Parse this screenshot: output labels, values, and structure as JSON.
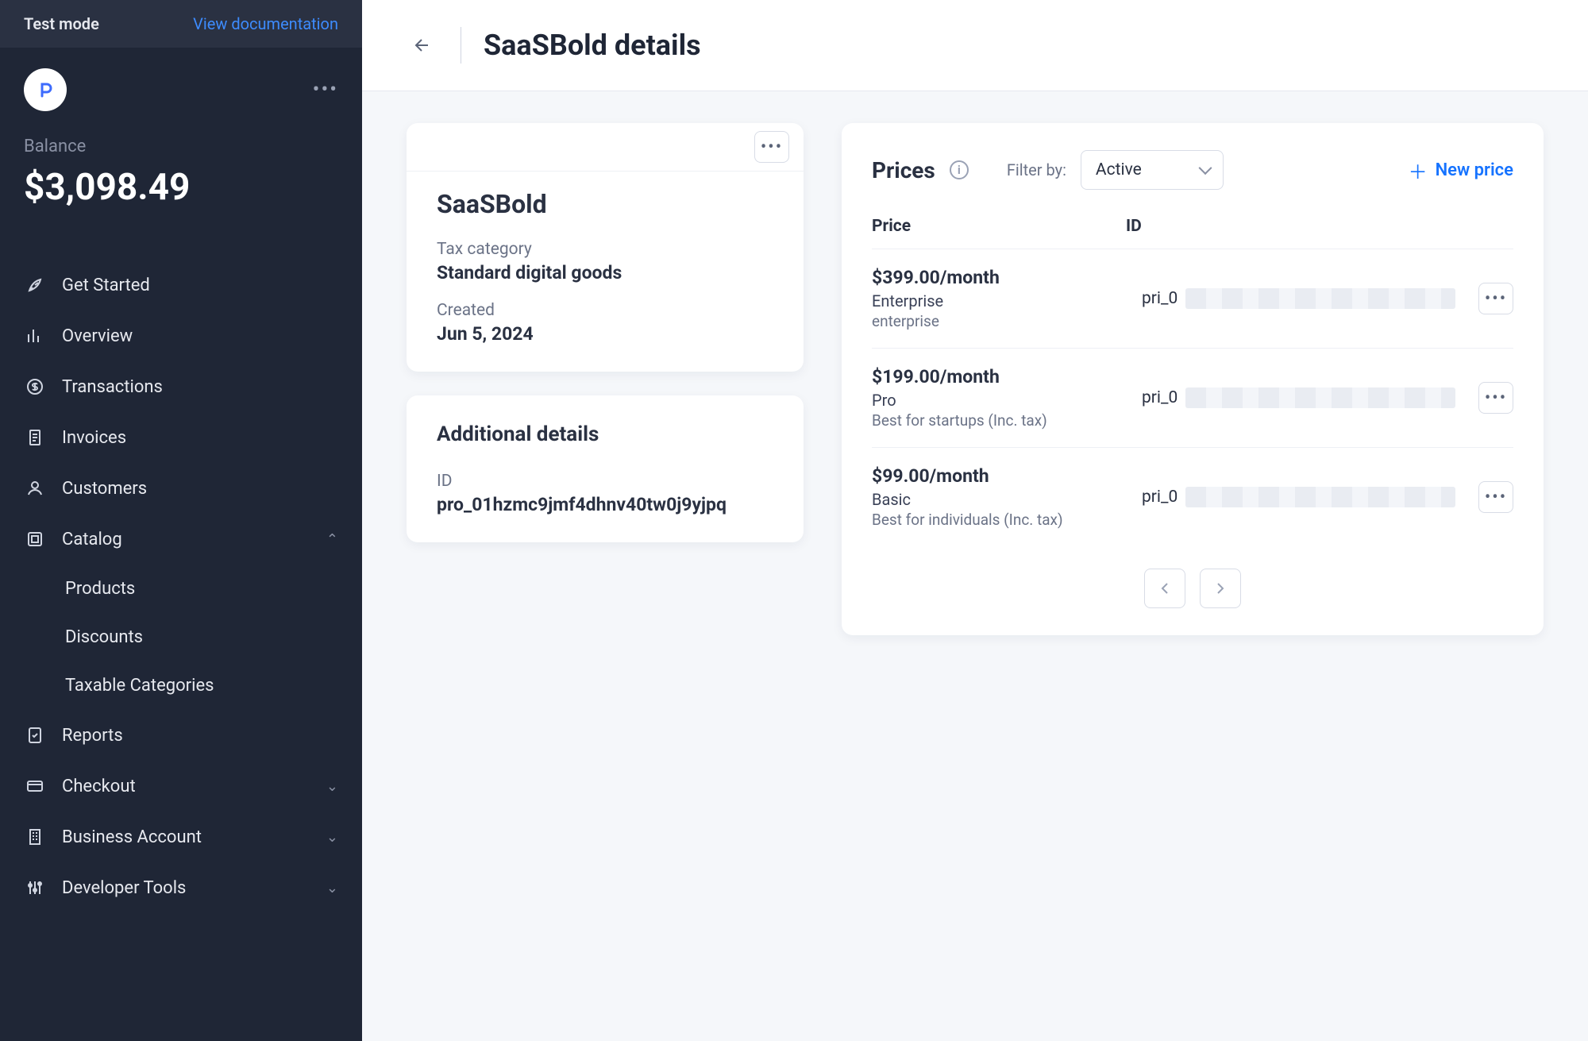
{
  "topbar": {
    "testmode": "Test mode",
    "viewdoc": "View documentation"
  },
  "balance": {
    "label": "Balance",
    "value": "$3,098.49"
  },
  "nav": {
    "get_started": "Get Started",
    "overview": "Overview",
    "transactions": "Transactions",
    "invoices": "Invoices",
    "customers": "Customers",
    "catalog": "Catalog",
    "products": "Products",
    "discounts": "Discounts",
    "taxable": "Taxable Categories",
    "reports": "Reports",
    "checkout": "Checkout",
    "business": "Business Account",
    "devtools": "Developer Tools"
  },
  "header": {
    "title": "SaaSBold details"
  },
  "product": {
    "name": "SaaSBold",
    "tax_label": "Tax category",
    "tax_value": "Standard digital goods",
    "created_label": "Created",
    "created_value": "Jun 5, 2024"
  },
  "additional": {
    "title": "Additional details",
    "id_label": "ID",
    "id_value": "pro_01hzmc9jmf4dhnv40tw0j9yjpq"
  },
  "prices": {
    "title": "Prices",
    "filter_label": "Filter by:",
    "filter_value": "Active",
    "new_label": "New price",
    "col_price": "Price",
    "col_id": "ID",
    "rows": [
      {
        "amount": "$399.00/month",
        "name": "Enterprise",
        "desc": "enterprise",
        "id_prefix": "pri_0"
      },
      {
        "amount": "$199.00/month",
        "name": "Pro",
        "desc": "Best for startups (Inc. tax)",
        "id_prefix": "pri_0"
      },
      {
        "amount": "$99.00/month",
        "name": "Basic",
        "desc": "Best for individuals (Inc. tax)",
        "id_prefix": "pri_0"
      }
    ]
  }
}
